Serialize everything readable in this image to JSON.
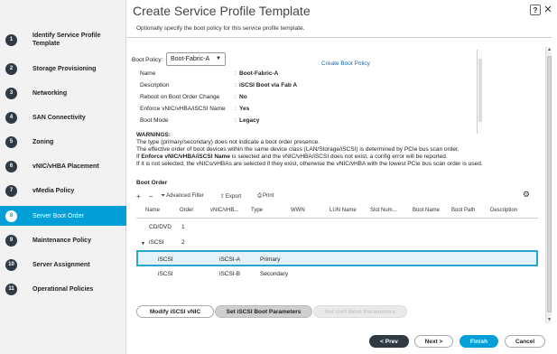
{
  "sidebar": {
    "steps": [
      {
        "num": "1",
        "label": "Identify Service Profile Template"
      },
      {
        "num": "2",
        "label": "Storage Provisioning"
      },
      {
        "num": "3",
        "label": "Networking"
      },
      {
        "num": "4",
        "label": "SAN Connectivity"
      },
      {
        "num": "5",
        "label": "Zoning"
      },
      {
        "num": "6",
        "label": "vNIC/vHBA Placement"
      },
      {
        "num": "7",
        "label": "vMedia Policy"
      },
      {
        "num": "8",
        "label": "Server Boot Order"
      },
      {
        "num": "9",
        "label": "Maintenance Policy"
      },
      {
        "num": "10",
        "label": "Server Assignment"
      },
      {
        "num": "11",
        "label": "Operational Policies"
      }
    ],
    "active_step": "8"
  },
  "header": {
    "title": "Create Service Profile Template",
    "help": "?",
    "close": "✕",
    "subtitle": "Optionally specify the boot policy for this service profile template."
  },
  "boot_policy": {
    "label": "Boot Policy:",
    "selected": "Boot-Fabric-A",
    "create_link": "Create Boot Policy"
  },
  "props": [
    {
      "key": "Name",
      "value": "Boot-Fabric-A"
    },
    {
      "key": "Description",
      "value": "iSCSI Boot via Fab A"
    },
    {
      "key": "Reboot on Boot Order Change",
      "value": "No"
    },
    {
      "key": "Enforce vNIC/vHBA/iSCSI Name",
      "value": "Yes"
    },
    {
      "key": "Boot Mode",
      "value": "Legacy"
    }
  ],
  "warnings": {
    "title": "WARNINGS:",
    "line1": "The type (primary/secondary) does not indicate a boot order presence.",
    "line2": "The effective order of boot devices within the same device class (LAN/Storage/iSCSI) is determined by PCIe bus scan order.",
    "line3_bold": "Enforce vNIC/vHBA/iSCSI Name",
    "line3_pre": "If ",
    "line3_post": " is selected and the vNIC/vHBA/iSCSI does not exist, a config error will be reported.",
    "line4": "If it is not selected, the vNICs/vHBAs are selected if they exist, otherwise the vNIC/vHBA with the lowest PCIe bus scan order is used."
  },
  "boot_order": {
    "title": "Boot Order",
    "toolbar": {
      "add": "+",
      "remove": "−",
      "filter": "Advanced Filter",
      "export": "Export",
      "print": "Print"
    },
    "columns": [
      "Name",
      "Order",
      "vNIC/vHB...",
      "Type",
      "WWN",
      "LUN Name",
      "Slot Num...",
      "Boot Name",
      "Boot Path",
      "Description"
    ],
    "rows": [
      {
        "name": "CD/DVD",
        "order": "1",
        "vnic": "",
        "type": ""
      },
      {
        "name": "iSCSI",
        "order": "2",
        "vnic": "",
        "type": ""
      },
      {
        "name": "iSCSI",
        "order": "",
        "vnic": "iSCSI-A",
        "type": "Primary"
      },
      {
        "name": "iSCSI",
        "order": "",
        "vnic": "iSCSI-B",
        "type": "Secondary"
      }
    ]
  },
  "actions": {
    "modify": "Modify iSCSI vNIC",
    "set_params": "Set iSCSI Boot Parameters",
    "set_uefi": "Set Uefi Boot Parameters"
  },
  "footer": {
    "prev": "< Prev",
    "next": "Next >",
    "finish": "Finish",
    "cancel": "Cancel"
  }
}
